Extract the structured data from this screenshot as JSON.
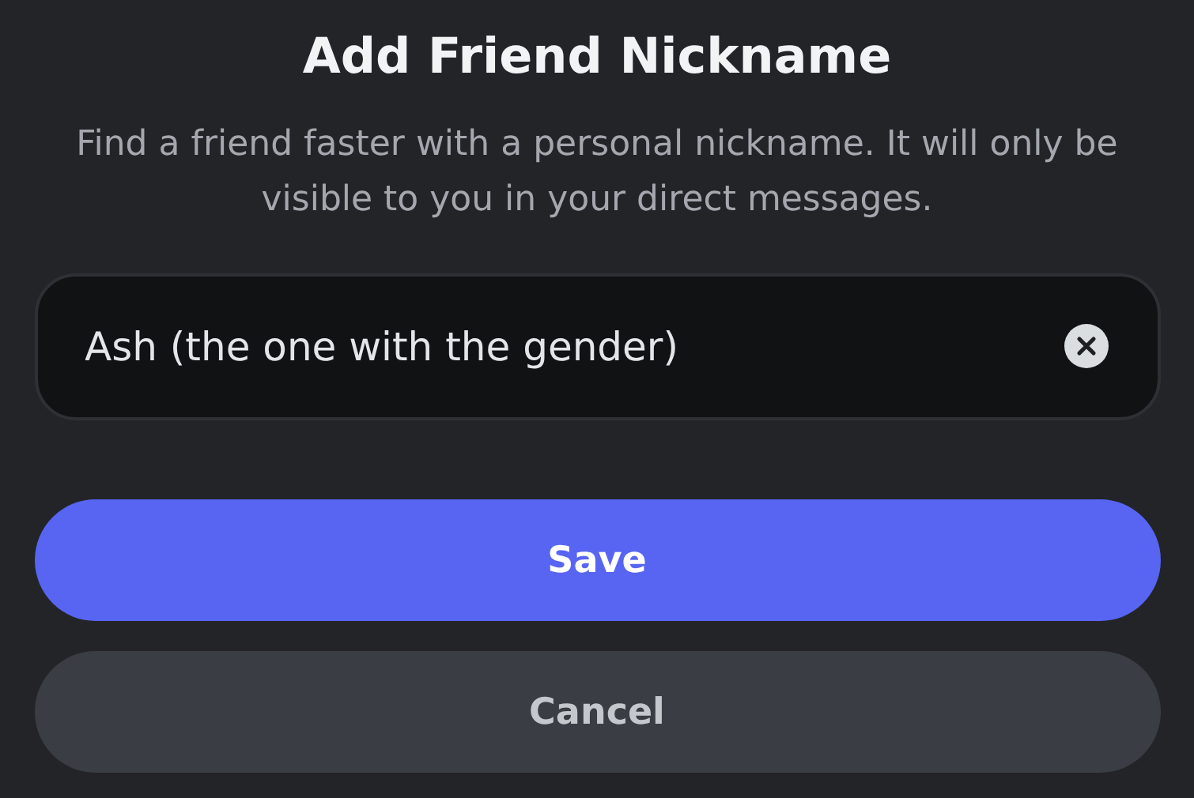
{
  "title": "Add Friend Nickname",
  "description": "Find a friend faster with a personal nickname. It will only be visible to you in your direct messages.",
  "nickname_field": {
    "value": "Ash (the one with the gender)"
  },
  "buttons": [
    {
      "label": "Save",
      "kind": "primary"
    },
    {
      "label": "Cancel",
      "kind": "secondary"
    }
  ]
}
